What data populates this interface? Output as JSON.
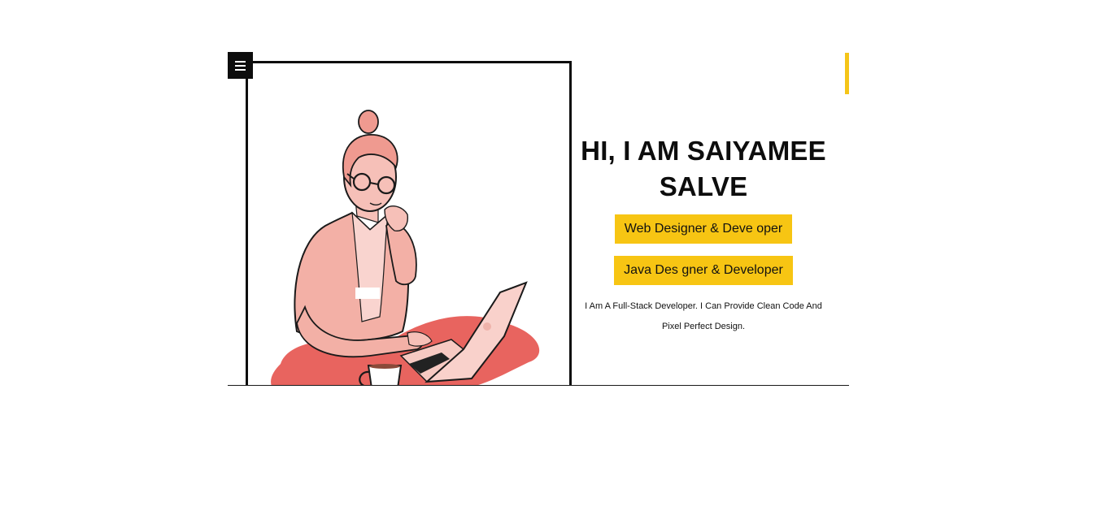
{
  "header": {
    "menu_icon": "hamburger-menu-icon"
  },
  "hero": {
    "name_line1": "HI, I AM SAIYAMEE",
    "name_line2": "SALVE",
    "roles": [
      "Web Designer & Deve oper",
      "Java Des gner & Developer"
    ],
    "description": "I Am A Full-Stack Developer. I Can Provide Clean Code And Pixel Perfect Design."
  },
  "colors": {
    "accent": "#f7c513",
    "frame": "#0d0d0d",
    "illustration_red": "#e8645f",
    "skin": "#f2a9a0"
  }
}
